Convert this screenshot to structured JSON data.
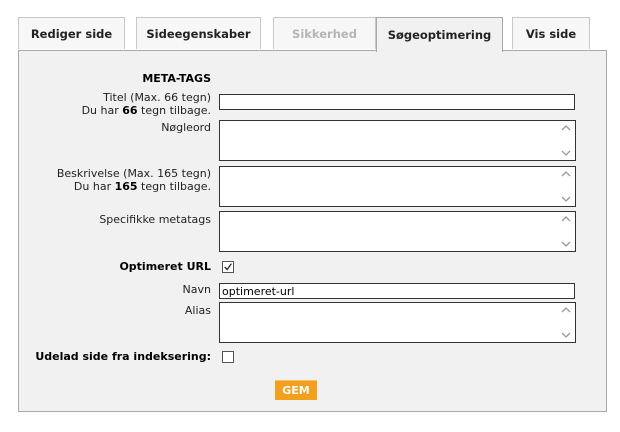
{
  "tabs": [
    {
      "label": "Rediger side",
      "state": "normal"
    },
    {
      "label": "Sideegenskaber",
      "state": "normal"
    },
    {
      "label": "Sikkerhed",
      "state": "disabled"
    },
    {
      "label": "Søgeoptimering",
      "state": "active"
    },
    {
      "label": "Vis side",
      "state": "normal"
    }
  ],
  "form": {
    "section_title": "META-TAGS",
    "title_label": "Titel (Max. 66 tegn)",
    "title_remaining_prefix": "Du har ",
    "title_remaining_count": "66",
    "title_remaining_suffix": " tegn tilbage.",
    "title_value": "",
    "keywords_label": "Nøgleord",
    "description_label": "Beskrivelse (Max. 165 tegn)",
    "description_remaining_prefix": "Du har ",
    "description_remaining_count": "165",
    "description_remaining_suffix": " tegn tilbage.",
    "specific_metatags_label": "Specifikke metatags",
    "optimized_url_label": "Optimeret URL",
    "optimized_url_checked": true,
    "name_label": "Navn",
    "name_value": "optimeret-url",
    "alias_label": "Alias",
    "exclude_indexing_label": "Udelad side fra indeksering:",
    "exclude_indexing_checked": false,
    "save_label": "GEM"
  },
  "colors": {
    "panel_bg": "#f1f1f1",
    "tab_border": "#c8c8c8",
    "save_button": "#f2a01e",
    "disabled_text": "#b5b5b5"
  }
}
